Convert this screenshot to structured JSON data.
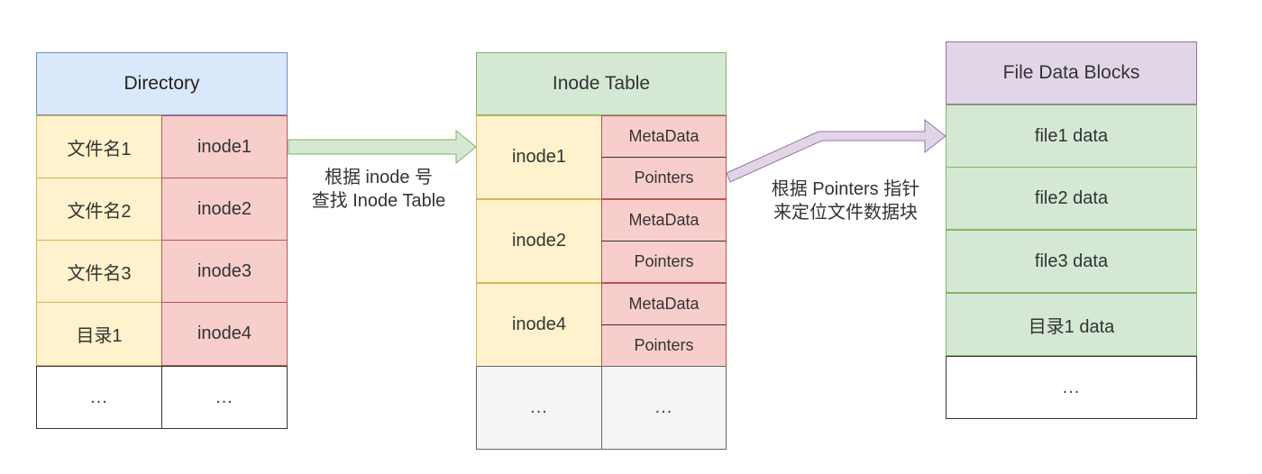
{
  "directory": {
    "title": "Directory",
    "rows": [
      {
        "name": "文件名1",
        "inode": "inode1"
      },
      {
        "name": "文件名2",
        "inode": "inode2"
      },
      {
        "name": "文件名3",
        "inode": "inode3"
      },
      {
        "name": "目录1",
        "inode": "inode4"
      }
    ],
    "ellipsis": [
      "...",
      "..."
    ]
  },
  "arrow1_label": [
    "根据 inode 号",
    "查找 Inode Table"
  ],
  "inode_table": {
    "title": "Inode Table",
    "entries": [
      {
        "inode": "inode1",
        "metadata": "MetaData",
        "pointers": "Pointers"
      },
      {
        "inode": "inode2",
        "metadata": "MetaData",
        "pointers": "Pointers"
      },
      {
        "inode": "inode4",
        "metadata": "MetaData",
        "pointers": "Pointers"
      }
    ],
    "ellipsis": [
      "...",
      "..."
    ]
  },
  "arrow2_label": [
    "根据 Pointers 指针",
    "来定位文件数据块"
  ],
  "file_data_blocks": {
    "title": "File Data Blocks",
    "blocks": [
      "file1 data",
      "file2 data",
      "file3 data",
      "目录1 data"
    ],
    "ellipsis": "..."
  },
  "colors": {
    "blue_header": "#dae8fc",
    "yellow": "#fff2cc",
    "red": "#f8cecc",
    "green": "#d5e8d4",
    "purple": "#e1d5e7",
    "gray": "#f5f5f5"
  }
}
